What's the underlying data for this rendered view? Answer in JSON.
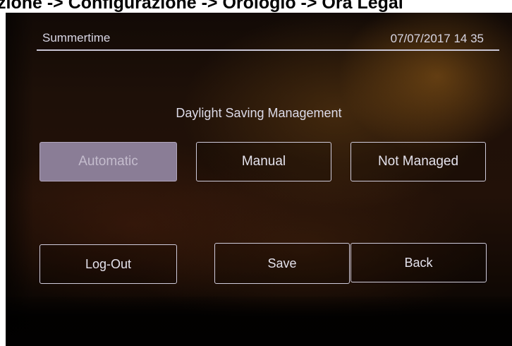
{
  "breadcrumb": "zione -> Configurazione -> Orologio -> Ora Legal",
  "header": {
    "title": "Summertime",
    "datetime": "07/07/2017 14 35"
  },
  "subtitle": "Daylight Saving Management",
  "mode_options": [
    {
      "label": "Automatic",
      "selected": true
    },
    {
      "label": "Manual",
      "selected": false
    },
    {
      "label": "Not Managed",
      "selected": false
    }
  ],
  "actions": {
    "logout_label": "Log-Out",
    "save_label": "Save",
    "back_label": "Back"
  },
  "colors": {
    "selected_button": "#8a7d96",
    "button_border": "#cfcbdb",
    "text": "#dddbe8"
  }
}
